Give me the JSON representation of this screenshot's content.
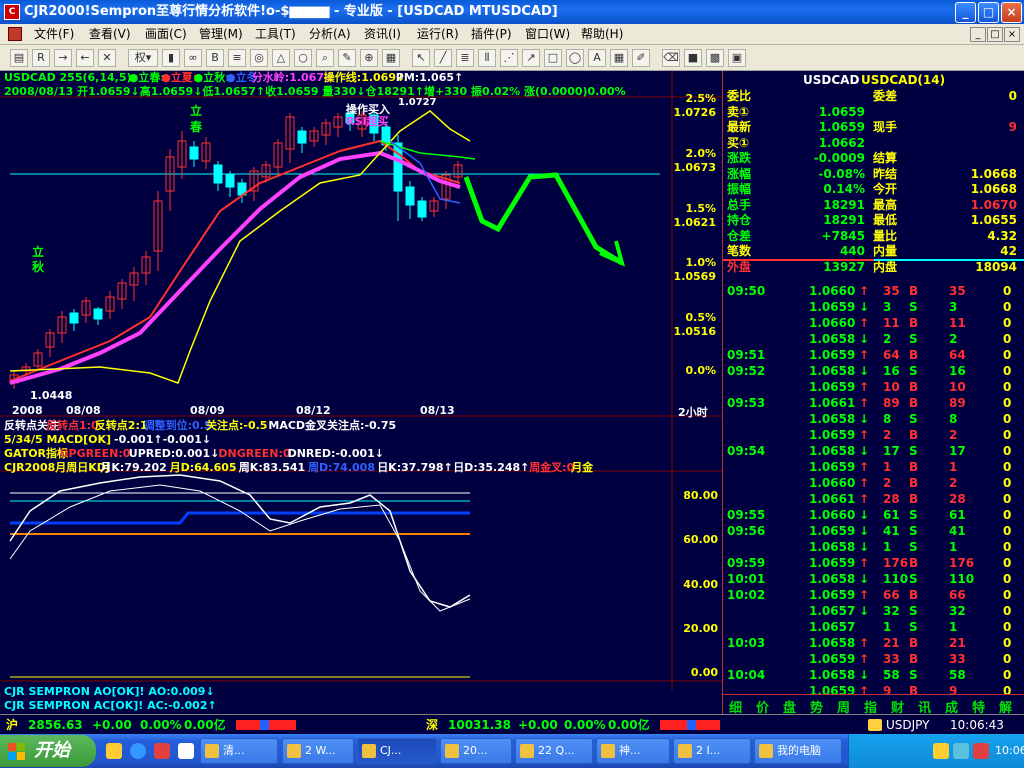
{
  "window": {
    "title": "CJR2000!Sempron至尊行情分析软件!o-$▆▆▆▆ - 专业版 - [USDCAD MTUSDCAD]",
    "app_icon": "app-logo-icon",
    "buttons": {
      "minimize": "_",
      "maximize": "□",
      "close": "×"
    }
  },
  "menu": {
    "items": [
      "文件(F)",
      "查看(V)",
      "画面(C)",
      "管理(M)",
      "工具(T)",
      "分析(A)",
      "资讯(I)",
      "运行(R)",
      "插件(P)",
      "窗口(W)",
      "帮助(H)"
    ],
    "mdi_buttons": [
      "_",
      "□",
      "×"
    ]
  },
  "toolbar": {
    "icons": [
      "folder-icon",
      "rsi-icon",
      "arrow-right-icon",
      "arrow-left-icon",
      "cross-icon",
      "period-select",
      "candle-icon",
      "cs-icon",
      "b-icon",
      "layers-icon",
      "target-icon",
      "triangle-icon",
      "circle-icon",
      "search-icon",
      "pencil-icon",
      "compass-icon",
      "chart-icon",
      "pointer-icon",
      "line-tool-icon",
      "fib-icon",
      "channel-icon",
      "gann-icon",
      "arrow-tool-icon",
      "rect-tool-icon",
      "ellipse-tool-icon",
      "text-tool-icon",
      "grid-icon",
      "pen-icon",
      "eraser-icon",
      "color-icon",
      "palette-icon",
      "save-icon"
    ],
    "period_label": "权"
  },
  "chart": {
    "header_line1": [
      {
        "text": "USDCAD 255(6,14,5)",
        "color": "#00ff00"
      },
      {
        "text": "●立春:",
        "color": "#00ff00"
      },
      {
        "text": "●立夏:",
        "color": "#ff3030"
      },
      {
        "text": "●立秋:",
        "color": "#00ff00"
      },
      {
        "text": "●立冬",
        "color": "#3060ff"
      },
      {
        "text": "分水岭:1.067↓",
        "color": "#ff40ff"
      },
      {
        "text": "操作线:1.069↓",
        "color": "#ffff00"
      },
      {
        "text": "PM:1.065↑",
        "color": "#ffffff"
      }
    ],
    "header_line2": "2008/08/13 开1.0659↓高1.0659↓低1.0657↑收1.0659 量330↓仓18291↑增+330 振0.02% 涨(0.0000)0.00%",
    "price_labels": [
      {
        "pct": "2.5%",
        "price": "1.0726"
      },
      {
        "pct": "2.0%",
        "price": "1.0673"
      },
      {
        "pct": "1.5%",
        "price": "1.0621"
      },
      {
        "pct": "1.0%",
        "price": "1.0569"
      },
      {
        "pct": "0.5%",
        "price": "1.0516"
      },
      {
        "pct": "0.0%",
        "price": ""
      }
    ],
    "low_label": "1.0448",
    "annotations": {
      "lichun": "立春",
      "liqiu": "立秋",
      "buy": "操作买入",
      "sell": "RSI超买",
      "price_top": "1.0727"
    },
    "date_axis": [
      "2008",
      "08/08",
      "08/09",
      "08/12",
      "08/13"
    ],
    "period": "2小时",
    "indicator_lines": [
      {
        "parts": [
          {
            "text": "反转点关注",
            "color": "#ffffff"
          },
          {
            "text": "反转点1:0",
            "color": "#ff3030"
          },
          {
            "text": "反转点2:1",
            "color": "#ffff00"
          },
          {
            "text": "调整到位:0.5",
            "color": "#3060ff"
          },
          {
            "text": "关注点:-0.5",
            "color": "#ffff00"
          },
          {
            "text": "MACD金叉关注点:-0.75",
            "color": "#ffffff"
          }
        ]
      },
      {
        "parts": [
          {
            "text": "5/34/5 MACD[OK]",
            "color": "#ffff00"
          },
          {
            "text": "-0.001↑-0.001↓",
            "color": "#ffffff"
          }
        ]
      },
      {
        "parts": [
          {
            "text": "GATOR指标",
            "color": "#ffff00"
          },
          {
            "text": "UPGREEN:0",
            "color": "#ff3030"
          },
          {
            "text": "UPRED:0.001↓",
            "color": "#ffffff"
          },
          {
            "text": "DNGREEN:0",
            "color": "#ff3030"
          },
          {
            "text": "DNRED:-0.001↓",
            "color": "#ffffff"
          }
        ]
      },
      {
        "parts": [
          {
            "text": "CJR2008月周日KDJ",
            "color": "#ffff00"
          },
          {
            "text": "月K:79.202",
            "color": "#ffffff"
          },
          {
            "text": "月D:64.605",
            "color": "#ffff00"
          },
          {
            "text": "周K:83.541",
            "color": "#ffffff"
          },
          {
            "text": "周D:74.008",
            "color": "#3060ff"
          },
          {
            "text": "日K:37.798↑",
            "color": "#ffffff"
          },
          {
            "text": "日D:35.248↑",
            "color": "#ffffff"
          },
          {
            "text": "周金叉:0",
            "color": "#ff3030"
          },
          {
            "text": "月金",
            "color": "#ffff00"
          }
        ]
      }
    ],
    "kdj_labels": [
      "80.00",
      "60.00",
      "40.00",
      "20.00",
      "0.00"
    ],
    "bottom_lines": [
      "CJR SEMPRON AO[OK]! AO:0.009↓",
      "CJR SEMPRON  AC[OK]! AC:-0.002↑"
    ]
  },
  "quote": {
    "title": "USDCAD",
    "title2": "USDCAD(14)",
    "rows": [
      {
        "l": "委比",
        "lv": "",
        "r": "委差",
        "rv": "0"
      },
      {
        "l": "卖①",
        "lv": "1.0659",
        "r": "",
        "rv": ""
      },
      {
        "l": "最新",
        "lv": "1.0659",
        "r": "现手",
        "rv": "9"
      },
      {
        "l": "买①",
        "lv": "1.0662",
        "r": "",
        "rv": ""
      },
      {
        "l": "涨跌",
        "lv": "-0.0009",
        "r": "结算",
        "rv": ""
      },
      {
        "l": "涨幅",
        "lv": "-0.08%",
        "r": "昨结",
        "rv": "1.0668"
      },
      {
        "l": "振幅",
        "lv": "0.14%",
        "r": "今开",
        "rv": "1.0668"
      },
      {
        "l": "总手",
        "lv": "18291",
        "r": "最高",
        "rv": "1.0670"
      },
      {
        "l": "持仓",
        "lv": "18291",
        "r": "最低",
        "rv": "1.0655"
      },
      {
        "l": "仓差",
        "lv": "+7845",
        "r": "量比",
        "rv": "4.32"
      },
      {
        "l": "笔数",
        "lv": "440",
        "r": "内量",
        "rv": "42"
      },
      {
        "l": "外盘",
        "lv": "13927",
        "r": "内盘",
        "rv": "18094"
      }
    ],
    "ticks": [
      {
        "t": "09:50",
        "p": "1.0660",
        "d": "↑",
        "v": "35",
        "bs": "B",
        "v2": "35",
        "z": "0"
      },
      {
        "t": "",
        "p": "1.0659",
        "d": "↓",
        "v": "3",
        "bs": "S",
        "v2": "3",
        "z": "0"
      },
      {
        "t": "",
        "p": "1.0660",
        "d": "↑",
        "v": "11",
        "bs": "B",
        "v2": "11",
        "z": "0"
      },
      {
        "t": "",
        "p": "1.0658",
        "d": "↓",
        "v": "2",
        "bs": "S",
        "v2": "2",
        "z": "0"
      },
      {
        "t": "09:51",
        "p": "1.0659",
        "d": "↑",
        "v": "64",
        "bs": "B",
        "v2": "64",
        "z": "0"
      },
      {
        "t": "09:52",
        "p": "1.0658",
        "d": "↓",
        "v": "16",
        "bs": "S",
        "v2": "16",
        "z": "0"
      },
      {
        "t": "",
        "p": "1.0659",
        "d": "↑",
        "v": "10",
        "bs": "B",
        "v2": "10",
        "z": "0"
      },
      {
        "t": "09:53",
        "p": "1.0661",
        "d": "↑",
        "v": "89",
        "bs": "B",
        "v2": "89",
        "z": "0"
      },
      {
        "t": "",
        "p": "1.0658",
        "d": "↓",
        "v": "8",
        "bs": "S",
        "v2": "8",
        "z": "0"
      },
      {
        "t": "",
        "p": "1.0659",
        "d": "↑",
        "v": "2",
        "bs": "B",
        "v2": "2",
        "z": "0"
      },
      {
        "t": "09:54",
        "p": "1.0658",
        "d": "↓",
        "v": "17",
        "bs": "S",
        "v2": "17",
        "z": "0"
      },
      {
        "t": "",
        "p": "1.0659",
        "d": "↑",
        "v": "1",
        "bs": "B",
        "v2": "1",
        "z": "0"
      },
      {
        "t": "",
        "p": "1.0660",
        "d": "↑",
        "v": "2",
        "bs": "B",
        "v2": "2",
        "z": "0"
      },
      {
        "t": "",
        "p": "1.0661",
        "d": "↑",
        "v": "28",
        "bs": "B",
        "v2": "28",
        "z": "0"
      },
      {
        "t": "09:55",
        "p": "1.0660",
        "d": "↓",
        "v": "61",
        "bs": "S",
        "v2": "61",
        "z": "0"
      },
      {
        "t": "09:56",
        "p": "1.0659",
        "d": "↓",
        "v": "41",
        "bs": "S",
        "v2": "41",
        "z": "0"
      },
      {
        "t": "",
        "p": "1.0658",
        "d": "↓",
        "v": "1",
        "bs": "S",
        "v2": "1",
        "z": "0"
      },
      {
        "t": "09:59",
        "p": "1.0659",
        "d": "↑",
        "v": "176",
        "bs": "B",
        "v2": "176",
        "z": "0"
      },
      {
        "t": "10:01",
        "p": "1.0658",
        "d": "↓",
        "v": "110",
        "bs": "S",
        "v2": "110",
        "z": "0"
      },
      {
        "t": "10:02",
        "p": "1.0659",
        "d": "↑",
        "v": "66",
        "bs": "B",
        "v2": "66",
        "z": "0"
      },
      {
        "t": "",
        "p": "1.0657",
        "d": "↓",
        "v": "32",
        "bs": "S",
        "v2": "32",
        "z": "0"
      },
      {
        "t": "",
        "p": "1.0657",
        "d": "",
        "v": "1",
        "bs": "S",
        "v2": "1",
        "z": "0"
      },
      {
        "t": "10:03",
        "p": "1.0658",
        "d": "↑",
        "v": "21",
        "bs": "B",
        "v2": "21",
        "z": "0"
      },
      {
        "t": "",
        "p": "1.0659",
        "d": "↑",
        "v": "33",
        "bs": "B",
        "v2": "33",
        "z": "0"
      },
      {
        "t": "10:04",
        "p": "1.0658",
        "d": "↓",
        "v": "58",
        "bs": "S",
        "v2": "58",
        "z": "0"
      },
      {
        "t": "",
        "p": "1.0659",
        "d": "↑",
        "v": "9",
        "bs": "B",
        "v2": "9",
        "z": "0"
      }
    ],
    "tabs": [
      "细",
      "价",
      "盘",
      "势",
      "周",
      "指",
      "财",
      "讯",
      "成",
      "特",
      "解"
    ]
  },
  "status": {
    "sh_label": "沪",
    "sh_value": "2856.63",
    "sh_change": "+0.00",
    "sh_pct": "0.00%",
    "sh_amt": "0.00亿",
    "sz_label": "深",
    "sz_value": "10031.38",
    "sz_change": "+0.00",
    "sz_pct": "0.00%",
    "sz_amt": "0.00亿",
    "pair": "USDJPY",
    "time": "10:06:43"
  },
  "taskbar": {
    "start": "开始",
    "items": [
      "清...",
      "2 W...",
      "CJ...",
      "20...",
      "22 Q...",
      "神...",
      "2 I...",
      "我的电脑"
    ],
    "clock": "10:06"
  },
  "colors": {
    "bg": "#000040",
    "up": "#ff3030",
    "down": "#00ffff",
    "accent_green": "#00ff00",
    "yellow": "#ffff00"
  }
}
